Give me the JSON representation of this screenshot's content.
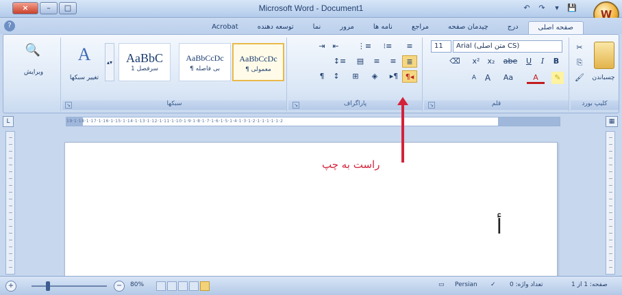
{
  "title": "Microsoft Word - Document1",
  "window_buttons": {
    "close": "×",
    "minimize": "–",
    "maximize": "□"
  },
  "quick_access": [
    "↶",
    "↷",
    "▾",
    "💾"
  ],
  "office_button": "W",
  "tabs": [
    {
      "label": "صفحه اصلی",
      "active": true
    },
    {
      "label": "درج",
      "active": false
    },
    {
      "label": "چیدمان صفحه",
      "active": false
    },
    {
      "label": "مراجع",
      "active": false
    },
    {
      "label": "نامه ها",
      "active": false
    },
    {
      "label": "مرور",
      "active": false
    },
    {
      "label": "نما",
      "active": false
    },
    {
      "label": "توسعه دهنده",
      "active": false
    },
    {
      "label": "Acrobat",
      "active": false
    }
  ],
  "groups": {
    "clipboard": {
      "label": "کلیپ بورد",
      "paste": "چسباندن"
    },
    "font": {
      "label": "قلم",
      "font_name": "Arial (متن اصلی CS)",
      "font_size": "11",
      "bold": "B",
      "italic": "I",
      "underline": "U",
      "strike": "abe",
      "subscript": "x₂",
      "superscript": "x²",
      "grow": "A",
      "shrink": "A",
      "case": "Aa",
      "color": "A"
    },
    "paragraph": {
      "label": "پاراگراف"
    },
    "styles": {
      "label": "سبکها",
      "items": [
        {
          "sample": "AaBbCcDc",
          "name": "¶ معمولی",
          "selected": true
        },
        {
          "sample": "AaBbCcDc",
          "name": "¶ بی فاصله",
          "selected": false
        },
        {
          "sample": "AaBbC",
          "name": "سرفصل 1",
          "selected": false
        }
      ],
      "change_styles": "تغییر سبکها"
    },
    "editing": {
      "label": "ویرایش"
    }
  },
  "ruler_numbers": "19·1·18·1·17·1·16·1·15·1·14·1·13·1·12·1·11·1·10·1·9·1·8·1·7·1·6·1·5·1·4·1·3·1·2·1·1·1·1·1·2",
  "document_text": "أ",
  "annotation": {
    "label": "راست به چپ",
    "color": "#d4223a"
  },
  "status": {
    "page": "صفحه: 1 از 1",
    "words": "تعداد واژه: 0",
    "language": "Persian",
    "zoom": "80%",
    "zoom_fraction": 0.8
  }
}
